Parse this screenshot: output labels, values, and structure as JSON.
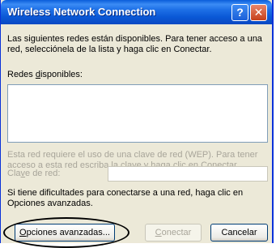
{
  "window": {
    "title": "Wireless Network Connection",
    "help_glyph": "?",
    "close_glyph": "✕"
  },
  "intro": {
    "line1": "Las siguientes redes están disponibles. Para tener acceso a una",
    "line2": "red, selecciónela de la lista y haga clic en Conectar."
  },
  "networks": {
    "label_pre": "Redes ",
    "label_acc": "d",
    "label_post": "isponibles:",
    "items": []
  },
  "wep_note": {
    "line1": "Esta red requiere el uso de una clave de red (WEP). Para tener",
    "line2": "acceso a esta red escriba la clave y haga clic en Conectar."
  },
  "key": {
    "label_pre": "Cla",
    "label_acc": "v",
    "label_post": "e de red:",
    "value": ""
  },
  "help_text": {
    "line1": "Si tiene dificultades para conectarse a una red, haga clic en",
    "line2": "Opciones avanzadas."
  },
  "buttons": {
    "advanced_acc": "O",
    "advanced_rest": "pciones avanzadas...",
    "connect_acc": "C",
    "connect_rest": "onectar",
    "cancel": "Cancelar"
  },
  "colors": {
    "title_bar": "#0a58d6",
    "dialog_bg": "#ece9d8",
    "disabled_text": "#a8a59a"
  }
}
